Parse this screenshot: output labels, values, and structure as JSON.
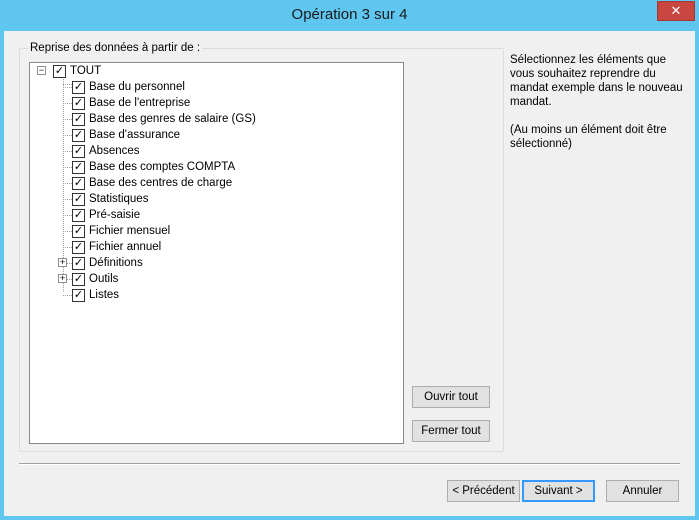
{
  "window": {
    "title": "Opération 3 sur 4",
    "close_glyph": "✕"
  },
  "group": {
    "label": "Reprise des données à partir de :"
  },
  "tree": {
    "root": {
      "label": "TOUT",
      "checked": true,
      "expander": "−"
    },
    "items": [
      {
        "label": "Base du personnel",
        "checked": true
      },
      {
        "label": "Base de l'entreprise",
        "checked": true
      },
      {
        "label": "Base des genres de salaire (GS)",
        "checked": true
      },
      {
        "label": "Base d'assurance",
        "checked": true
      },
      {
        "label": "Absences",
        "checked": true
      },
      {
        "label": "Base des comptes COMPTA",
        "checked": true
      },
      {
        "label": "Base des centres de charge",
        "checked": true
      },
      {
        "label": "Statistiques",
        "checked": true
      },
      {
        "label": "Pré-saisie",
        "checked": true
      },
      {
        "label": "Fichier mensuel",
        "checked": true
      },
      {
        "label": "Fichier annuel",
        "checked": true
      },
      {
        "label": "Définitions",
        "checked": true,
        "expander": "+"
      },
      {
        "label": "Outils",
        "checked": true,
        "expander": "+"
      },
      {
        "label": "Listes",
        "checked": true
      }
    ],
    "check_glyph": "✓"
  },
  "buttons": {
    "expand_all": "Ouvrir tout",
    "collapse_all": "Fermer tout",
    "previous": "< Précédent",
    "next": "Suivant >",
    "cancel": "Annuler"
  },
  "help": {
    "line1": "Sélectionnez les éléments que vous souhaitez reprendre du mandat exemple dans le nouveau mandat.",
    "line2": "(Au moins un élément doit être sélectionné)"
  },
  "colors": {
    "title_bar": "#5fc7ef",
    "close_button": "#c7463f",
    "dialog_background": "#f0f0f0"
  }
}
